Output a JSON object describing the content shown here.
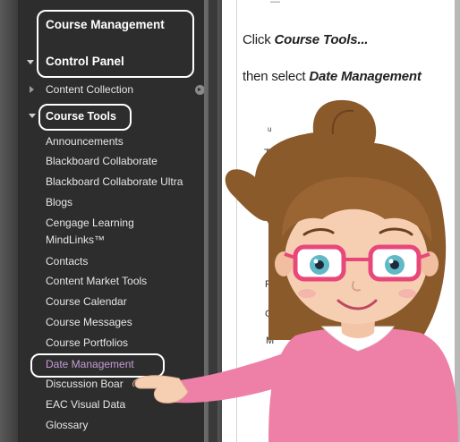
{
  "sidebar": {
    "course_management": "Course Management",
    "control_panel": "Control Panel",
    "content_collection": "Content Collection",
    "course_tools": "Course Tools",
    "items": [
      {
        "label": "Announcements"
      },
      {
        "label": "Blackboard Collaborate"
      },
      {
        "label": "Blackboard Collaborate Ultra"
      },
      {
        "label": "Blogs"
      },
      {
        "label": "Cengage Learning"
      },
      {
        "label": "MindLinks™"
      },
      {
        "label": "Contacts"
      },
      {
        "label": "Content Market Tools"
      },
      {
        "label": "Course Calendar"
      },
      {
        "label": "Course Messages"
      },
      {
        "label": "Course Portfolios"
      },
      {
        "label": "Date Management"
      },
      {
        "label": "Discussion Boar"
      },
      {
        "label": "EAC Visual Data"
      },
      {
        "label": "Glossary"
      }
    ]
  },
  "instructions": {
    "line1_prefix": "Click ",
    "line1_bold": "Course Tools",
    "line1_suffix": "...",
    "line2_prefix": "then select ",
    "line2_bold": "Date Management"
  },
  "partial_text": {
    "top": "—",
    "un": "u",
    "th": "Th",
    "pc": "Pc",
    "ge": "Ge",
    "m": "M"
  },
  "colors": {
    "sidebar_bg": "#2d2d2d",
    "highlight_link": "#c79bd8",
    "glasses": "#e8477a",
    "shirt": "#ee7fa7"
  },
  "icons": [
    "expand-arrow-icon",
    "collapse-arrow-icon",
    "go-circle-icon"
  ]
}
